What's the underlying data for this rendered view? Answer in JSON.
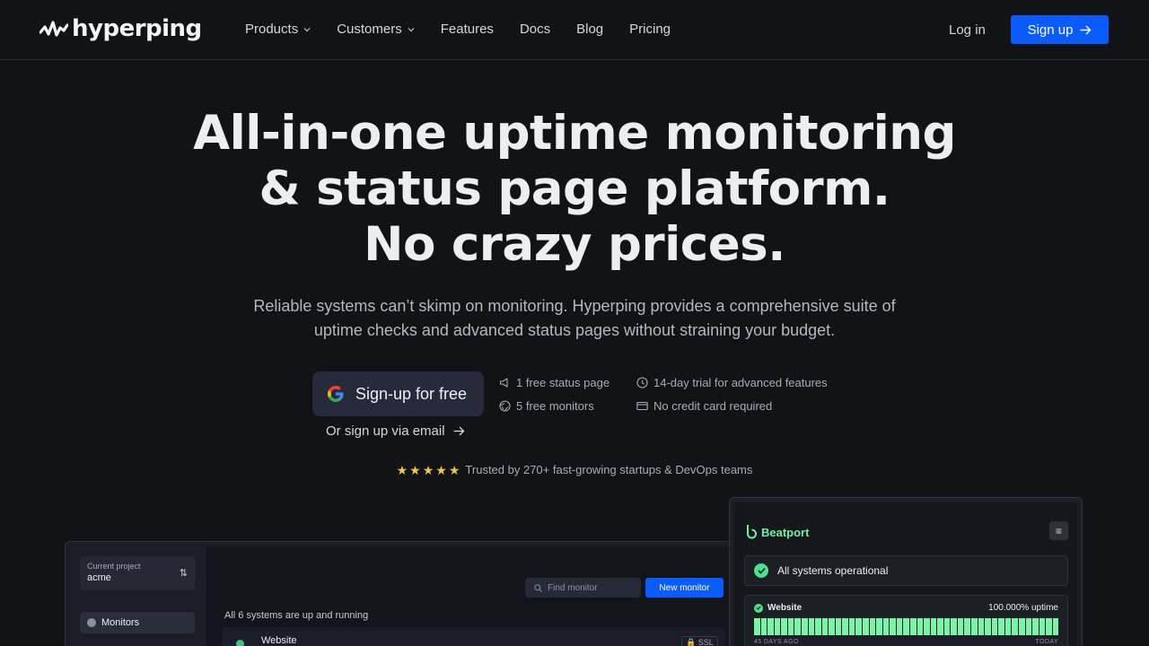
{
  "nav": {
    "brand": "hyperping",
    "links": [
      {
        "label": "Products",
        "dropdown": true
      },
      {
        "label": "Customers",
        "dropdown": true
      },
      {
        "label": "Features",
        "dropdown": false
      },
      {
        "label": "Docs",
        "dropdown": false
      },
      {
        "label": "Blog",
        "dropdown": false
      },
      {
        "label": "Pricing",
        "dropdown": false
      }
    ],
    "login": "Log in",
    "signup": "Sign up"
  },
  "hero": {
    "title_line1": "All-in-one uptime monitoring",
    "title_line2": "& status page platform.",
    "title_line3": "No crazy prices.",
    "subtitle_line1": "Reliable systems can’t skimp on monitoring. Hyperping provides a comprehensive suite of",
    "subtitle_line2": "uptime checks and advanced status pages without straining your budget.",
    "google_cta": "Sign-up for free",
    "email_cta": "Or sign up via email",
    "features": [
      {
        "icon": "megaphone-icon",
        "label": "1 free status page"
      },
      {
        "icon": "clock-icon",
        "label": "14-day trial for advanced features"
      },
      {
        "icon": "globe-icon",
        "label": "5 free monitors"
      },
      {
        "icon": "credit-card-icon",
        "label": "No credit card required"
      }
    ],
    "rating": 5,
    "trust": "Trusted by 270+ fast-growing startups & DevOps teams"
  },
  "colors": {
    "background": "#121317",
    "primary": "#0b5cff",
    "success": "#4ee08c",
    "star": "#f5c445"
  },
  "dashboard": {
    "project_label": "Current project",
    "project_name": "acme",
    "sidebar_item": "Monitors",
    "search_placeholder": "Find monitor",
    "new_monitor": "New monitor",
    "summary": "All 6 systems are up and running",
    "row_name": "Website",
    "row_badge": "SSL"
  },
  "status_page": {
    "brand": "Beatport",
    "overall": "All systems operational",
    "monitor_name": "Website",
    "monitor_uptime": "100.000% uptime",
    "range_start": "45 DAYS AGO",
    "range_end": "TODAY"
  }
}
